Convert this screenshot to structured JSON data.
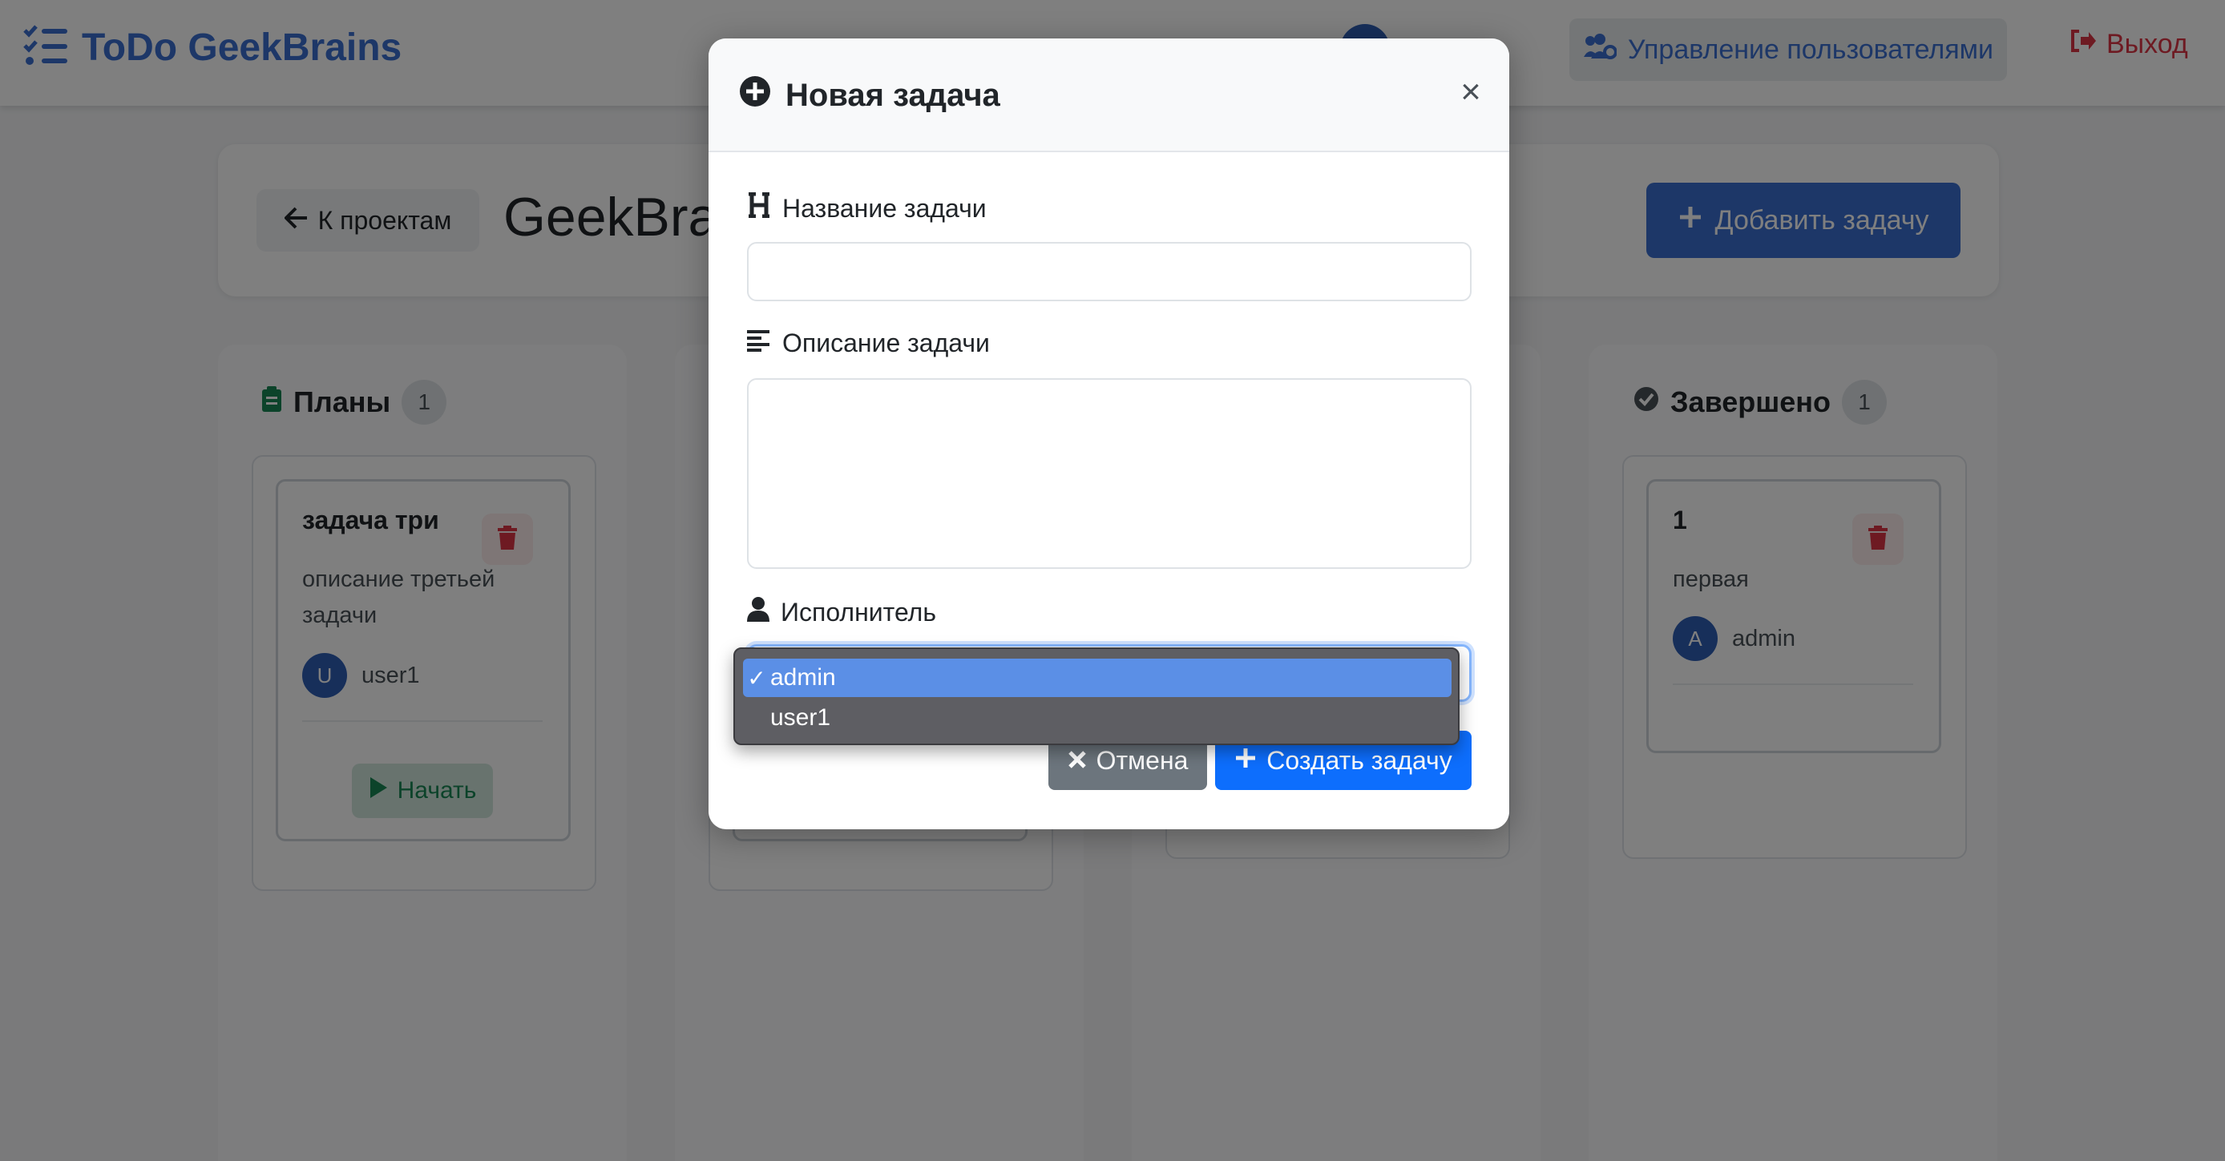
{
  "navbar": {
    "brand": "ToDo GeekBrains",
    "manage_users": "Управление пользователями",
    "logout": "Выход"
  },
  "project": {
    "back": "К проектам",
    "title": "GeekBra",
    "add_task": "Добавить задачу"
  },
  "columns": [
    {
      "title": "Планы",
      "count": "1",
      "card": {
        "title": "задача три",
        "description": "описание третьей задачи",
        "assignee_initial": "U",
        "assignee": "user1",
        "action": "Начать"
      }
    },
    {
      "title": "Завершено",
      "count": "1",
      "card": {
        "title": "1",
        "description": "первая",
        "assignee_initial": "A",
        "assignee": "admin"
      }
    }
  ],
  "modal": {
    "title": "Новая задача",
    "close": "×",
    "name_label": "Название задачи",
    "name_value": "",
    "description_label": "Описание задачи",
    "description_value": "",
    "assignee_label": "Исполнитель",
    "assignee_selected": "admin",
    "assignee_options": [
      "admin",
      "user1"
    ],
    "cancel": "Отмена",
    "create": "Создать задачу"
  },
  "colors": {
    "brand": "#3a6fd0",
    "danger": "#dc3545",
    "primary": "#0d6efd",
    "secondary": "#6c757d",
    "success": "#198754"
  }
}
